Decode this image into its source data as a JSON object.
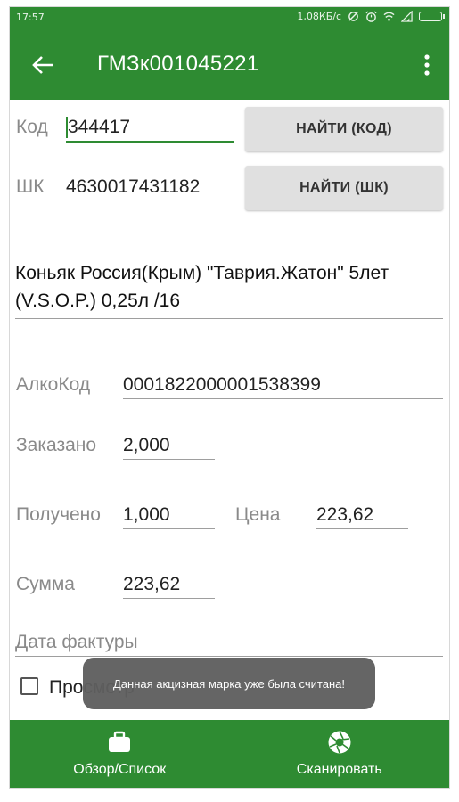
{
  "status_bar": {
    "time": "17:57",
    "net_speed": "1,08КБ/с",
    "icons": [
      "sync-off-icon",
      "alarm-icon",
      "wifi-icon",
      "signal-icon",
      "battery-icon"
    ]
  },
  "app_bar": {
    "title": "ГМЗк001045221",
    "back_icon": "arrow-back-icon",
    "menu_icon": "more-vert-icon"
  },
  "form": {
    "code_label": "Код",
    "code_value": "344417",
    "find_code_button": "НАЙТИ (КОД)",
    "barcode_label": "ШК",
    "barcode_value": "4630017431182",
    "find_barcode_button": "НАЙТИ (ШК)",
    "product_name": "Коньяк Россия(Крым) \"Таврия.Жатон\" 5лет (V.S.O.P.) 0,25л /16",
    "alco_code_label": "АлкоКод",
    "alco_code_value": "0001822000001538399",
    "ordered_label": "Заказано",
    "ordered_value": "2,000",
    "received_label": "Получено",
    "received_value": "1,000",
    "price_label": "Цена",
    "price_value": "223,62",
    "sum_label": "Сумма",
    "sum_value": "223,62",
    "invoice_date_placeholder": "Дата фактуры",
    "checkbox_label": "Просмотр"
  },
  "toast": {
    "message": "Данная акцизная марка уже была считана!"
  },
  "bottom_nav": {
    "overview_label": "Обзор/Список",
    "scan_label": "Сканировать"
  },
  "colors": {
    "primary": "#2e8b32",
    "button_bg": "#e0e0e0",
    "toast_bg": "#5f5f5f"
  }
}
